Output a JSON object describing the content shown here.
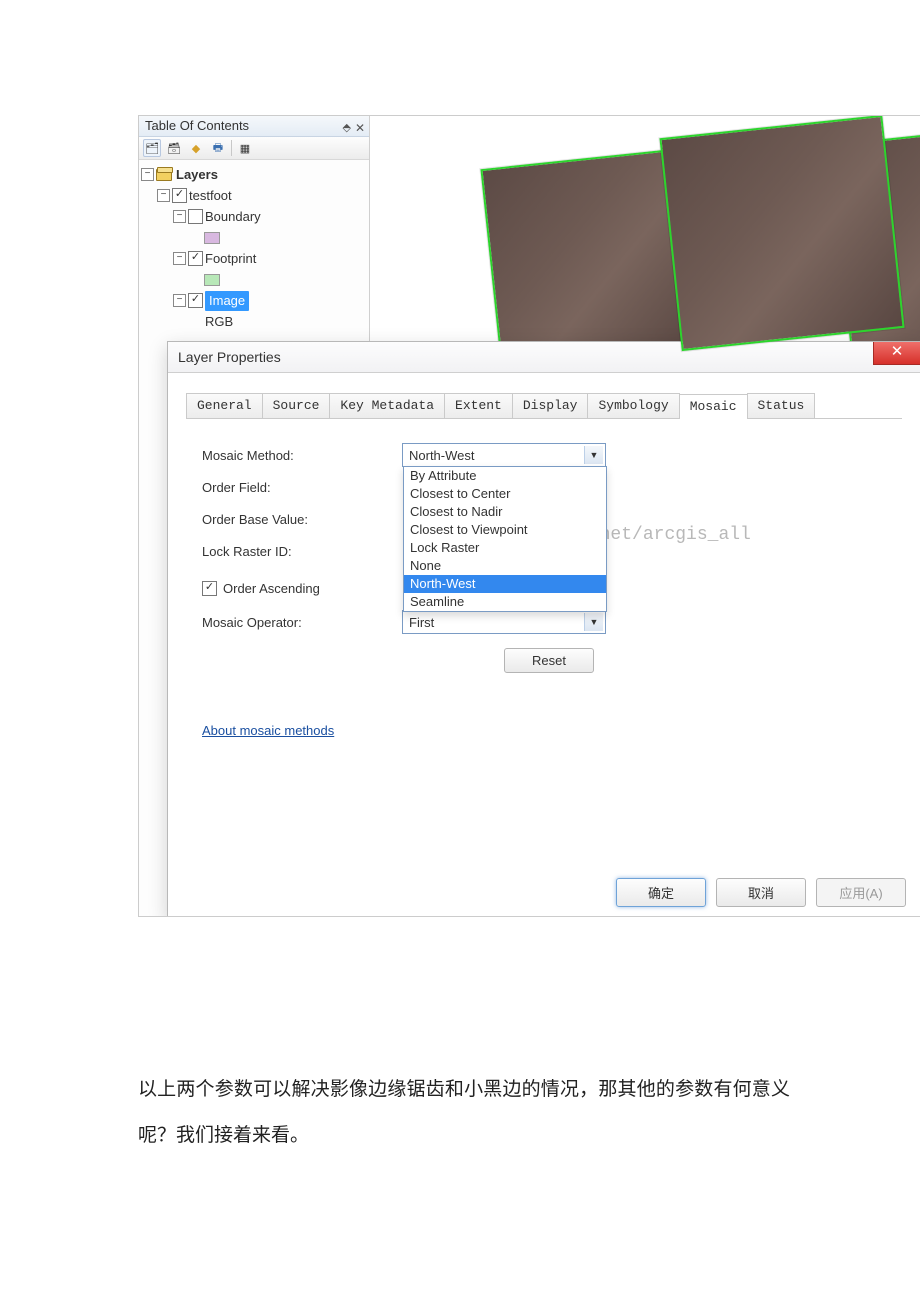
{
  "toc": {
    "title": "Table Of Contents",
    "layers_label": "Layers",
    "items": {
      "testfoot": "testfoot",
      "boundary": "Boundary",
      "footprint": "Footprint",
      "image": "Image",
      "rgb": "RGB"
    }
  },
  "dialog": {
    "title": "Layer Properties",
    "tabs": [
      "General",
      "Source",
      "Key Metadata",
      "Extent",
      "Display",
      "Symbology",
      "Mosaic",
      "Status"
    ],
    "labels": {
      "mosaic_method": "Mosaic Method:",
      "order_field": "Order Field:",
      "order_base_value": "Order Base Value:",
      "lock_raster_id": "Lock Raster ID:",
      "order_ascending": "Order Ascending",
      "mosaic_operator": "Mosaic Operator:"
    },
    "mosaic_method_value": "North-West",
    "mosaic_method_options": [
      "By Attribute",
      "Closest to Center",
      "Closest to Nadir",
      "Closest to Viewpoint",
      "Lock Raster",
      "None",
      "North-West",
      "Seamline"
    ],
    "mosaic_operator_value": "First",
    "reset": "Reset",
    "about_link": "About mosaic methods",
    "ok": "确定",
    "cancel": "取消",
    "apply": "应用(A)"
  },
  "watermark": "http://blog.csdn.net/arcgis_all",
  "article": {
    "p1": "以上两个参数可以解决影像边缘锯齿和小黑边的情况，那其他的参数有何意义呢？我们接着来看。"
  }
}
